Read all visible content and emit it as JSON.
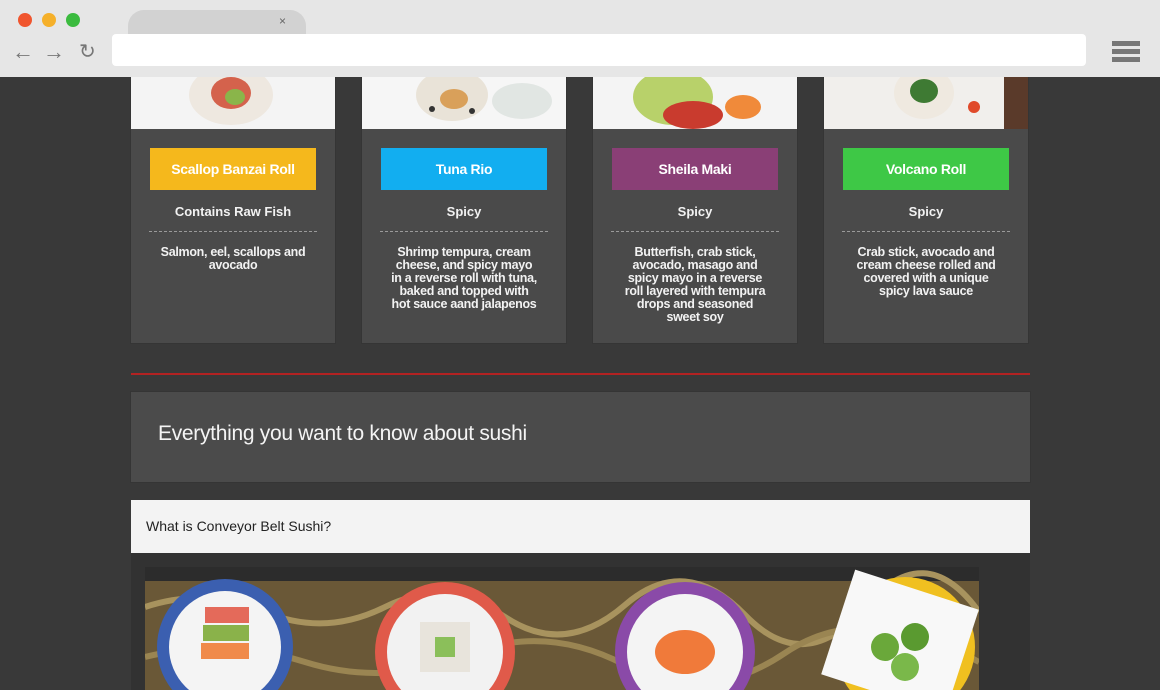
{
  "browser": {
    "tab_close": "×",
    "back": "←",
    "forward": "→",
    "reload": "↻"
  },
  "rolls": [
    {
      "name": "Scallop Banzai Roll",
      "tag": "Contains Raw Fish",
      "desc": "Salmon, eel, scallops and avocado",
      "color": "#f5b81c"
    },
    {
      "name": "Tuna Rio",
      "tag": "Spicy",
      "desc": "Shrimp tempura, cream cheese, and spicy mayo in a reverse roll with tuna, baked and topped with hot sauce aand jalapenos",
      "color": "#12aef0"
    },
    {
      "name": "Sheila Maki",
      "tag": "Spicy",
      "desc": "Butterfish, crab stick, avocado, masago and spicy mayo in a reverse roll layered with tempura drops and seasoned sweet soy",
      "color": "#8a3f76"
    },
    {
      "name": "Volcano Roll",
      "tag": "Spicy",
      "desc": "Crab stick, avocado and cream cheese rolled and covered with a unique spicy lava sauce",
      "color": "#3ec846"
    }
  ],
  "hero": {
    "title": "Everything you want to know about sushi"
  },
  "faq": {
    "question": "What is Conveyor Belt Sushi?"
  },
  "colors": {
    "divider": "#b32222",
    "background": "#393939",
    "card": "#4a4a4a"
  }
}
